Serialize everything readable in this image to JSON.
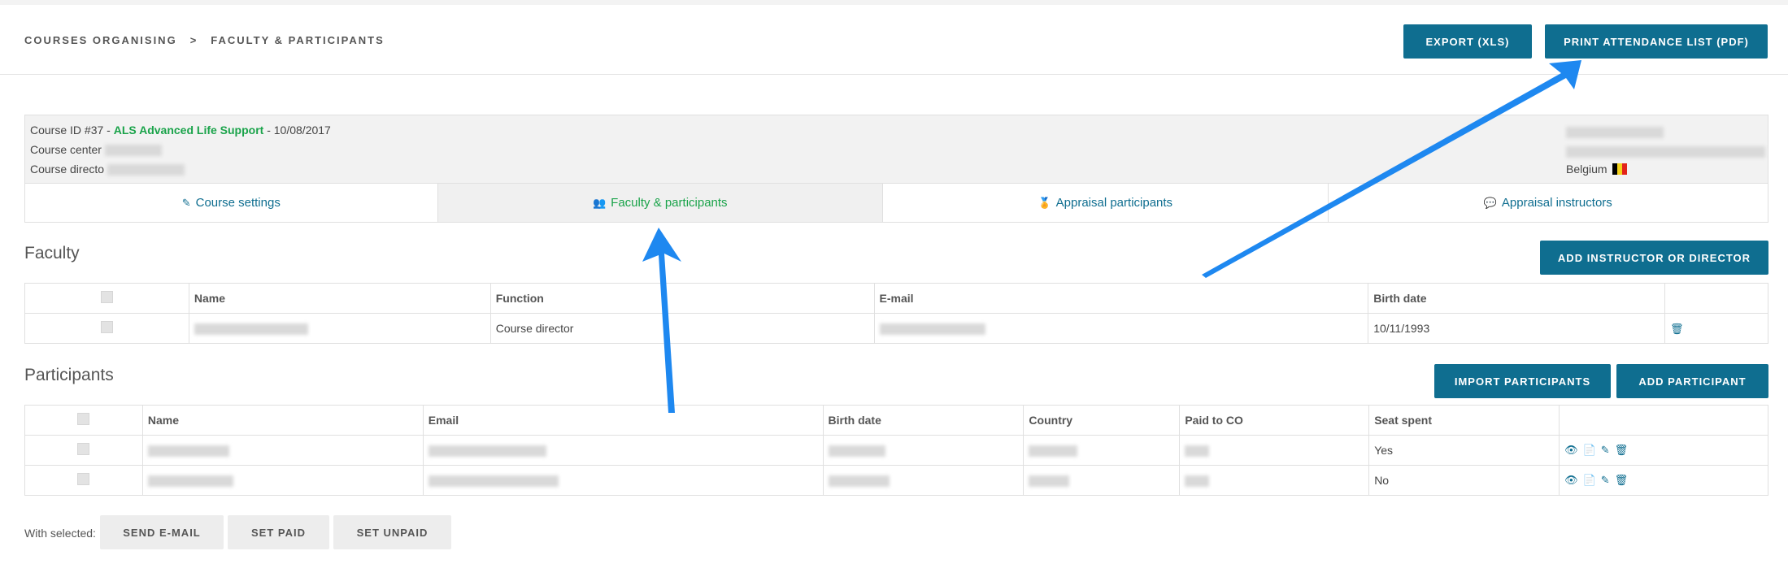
{
  "breadcrumb": {
    "item1": "COURSES ORGANISING",
    "sep": ">",
    "item2": "FACULTY & PARTICIPANTS"
  },
  "header_buttons": {
    "export": "EXPORT (XLS)",
    "print": "PRINT ATTENDANCE LIST (PDF)"
  },
  "course": {
    "id_prefix": "Course ID #37 - ",
    "name": "ALS Advanced Life Support",
    "date_suffix": " - 10/08/2017",
    "center_label": "Course center",
    "director_label": "Course directo",
    "country": "Belgium"
  },
  "tabs": [
    {
      "label": "Course settings",
      "icon": "pencil-icon"
    },
    {
      "label": "Faculty & participants",
      "icon": "users-icon"
    },
    {
      "label": "Appraisal participants",
      "icon": "medal-icon"
    },
    {
      "label": "Appraisal instructors",
      "icon": "chat-icon"
    }
  ],
  "faculty": {
    "title": "Faculty",
    "add_button": "ADD INSTRUCTOR OR DIRECTOR",
    "columns": [
      "Name",
      "Function",
      "E-mail",
      "Birth date"
    ],
    "rows": [
      {
        "function": "Course director",
        "birth_date": "10/11/1993"
      }
    ]
  },
  "participants": {
    "title": "Participants",
    "import_button": "IMPORT PARTICIPANTS",
    "add_button": "ADD PARTICIPANT",
    "columns": [
      "Name",
      "Email",
      "Birth date",
      "Country",
      "Paid to CO",
      "Seat spent"
    ],
    "rows": [
      {
        "seat_spent": "Yes"
      },
      {
        "seat_spent": "No"
      }
    ]
  },
  "bulk": {
    "label": "With selected:",
    "send_email": "SEND E-MAIL",
    "set_paid": "SET PAID",
    "set_unpaid": "SET UNPAID"
  },
  "colors": {
    "primary": "#0f6e90",
    "accent_green": "#1aa34a",
    "arrow": "#1e88f0"
  }
}
